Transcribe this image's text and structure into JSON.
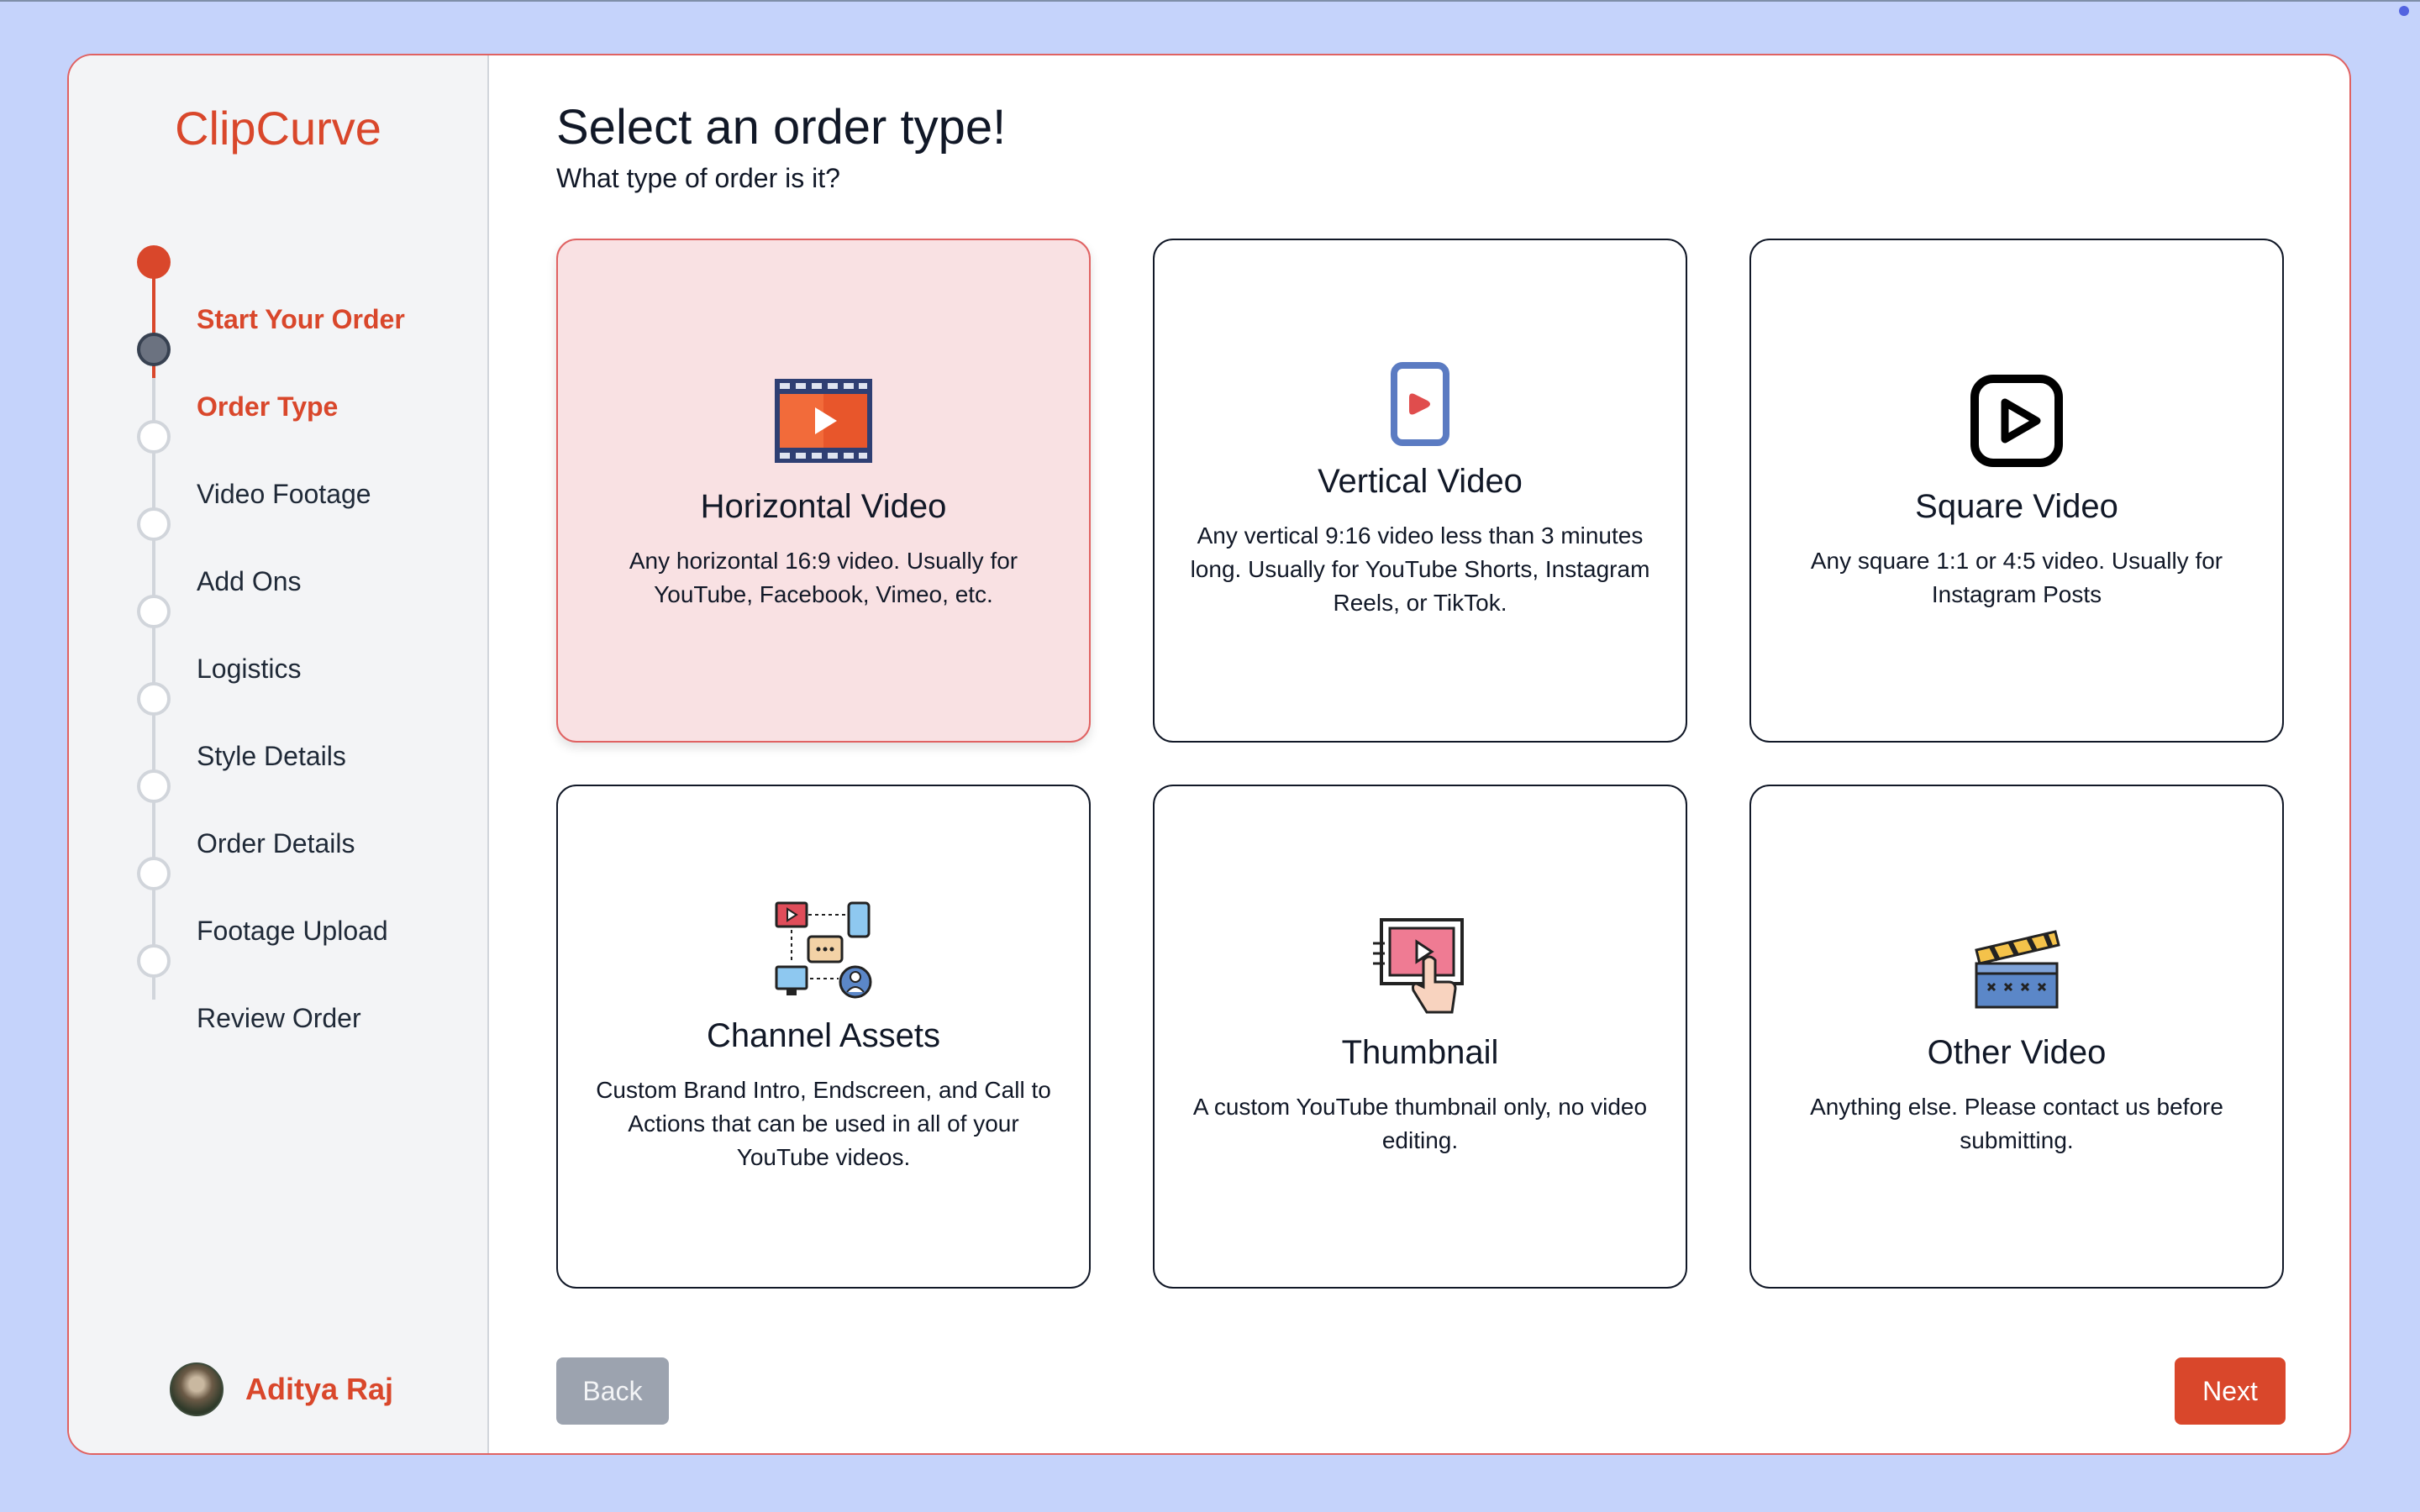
{
  "app": {
    "brand": "ClipCurve",
    "accent_color": "#d9472b"
  },
  "sidebar": {
    "steps": [
      {
        "label": "Start Your Order",
        "state": "completed"
      },
      {
        "label": "Order Type",
        "state": "current"
      },
      {
        "label": "Video Footage",
        "state": "upcoming"
      },
      {
        "label": "Add Ons",
        "state": "upcoming"
      },
      {
        "label": "Logistics",
        "state": "upcoming"
      },
      {
        "label": "Style Details",
        "state": "upcoming"
      },
      {
        "label": "Order Details",
        "state": "upcoming"
      },
      {
        "label": "Footage Upload",
        "state": "upcoming"
      },
      {
        "label": "Review Order",
        "state": "upcoming"
      }
    ],
    "user": {
      "name": "Aditya Raj"
    }
  },
  "main": {
    "title": "Select an order type!",
    "subtitle": "What type of order is it?",
    "options": [
      {
        "title": "Horizontal Video",
        "description": "Any horizontal 16:9 video. Usually for YouTube, Facebook, Vimeo, etc.",
        "icon": "film-strip-play-icon",
        "selected": true
      },
      {
        "title": "Vertical Video",
        "description": "Any vertical 9:16 video less than 3 minutes long. Usually for YouTube Shorts, Instagram Reels, or TikTok.",
        "icon": "phone-video-icon",
        "selected": false
      },
      {
        "title": "Square Video",
        "description": "Any square 1:1 or 4:5 video. Usually for Instagram Posts",
        "icon": "square-play-icon",
        "selected": false
      },
      {
        "title": "Channel Assets",
        "description": "Custom Brand Intro, Endscreen, and Call to Actions that can be used in all of your YouTube videos.",
        "icon": "channel-assets-icon",
        "selected": false
      },
      {
        "title": "Thumbnail",
        "description": "A custom YouTube thumbnail only, no video editing.",
        "icon": "thumbnail-tap-icon",
        "selected": false
      },
      {
        "title": "Other Video",
        "description": "Anything else. Please contact us before submitting.",
        "icon": "clapperboard-icon",
        "selected": false
      }
    ],
    "back_label": "Back",
    "next_label": "Next"
  }
}
